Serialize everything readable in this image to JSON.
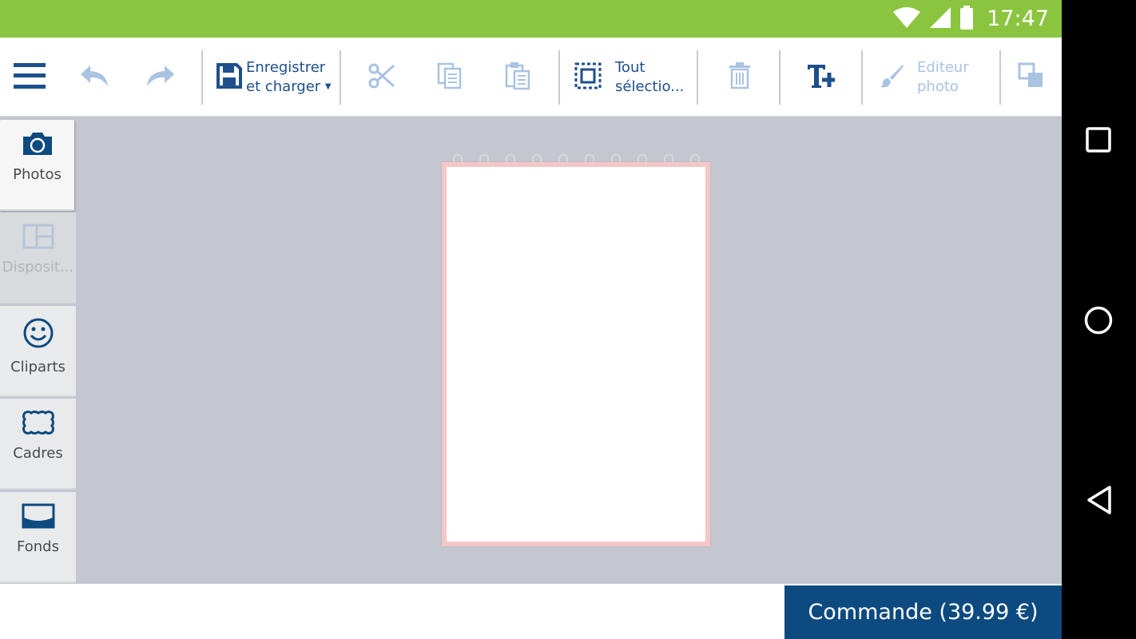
{
  "status_bar": {
    "time": "17:47",
    "background": "#8bc53f",
    "icons": [
      "wifi-icon",
      "signal-icon",
      "battery-icon"
    ]
  },
  "toolbar": {
    "save_load_label_line1": "Enregistrer",
    "save_load_label_line2": "et charger",
    "select_all_label_line1": "Tout",
    "select_all_label_line2": "sélectio...",
    "photo_editor_label_line1": "Editeur",
    "photo_editor_label_line2": "photo",
    "icons": [
      "menu-icon",
      "undo-icon",
      "redo-icon",
      "save-icon",
      "cut-icon",
      "copy-icon",
      "paste-icon",
      "select-all-icon",
      "delete-icon",
      "add-text-icon",
      "brush-icon",
      "arrange-icon"
    ]
  },
  "sidebar": {
    "items": [
      {
        "label": "Photos",
        "icon": "camera-icon",
        "state": "active"
      },
      {
        "label": "Disposit...",
        "icon": "layout-icon",
        "state": "disabled"
      },
      {
        "label": "Cliparts",
        "icon": "smiley-icon",
        "state": "normal"
      },
      {
        "label": "Cadres",
        "icon": "frame-icon",
        "state": "normal"
      },
      {
        "label": "Fonds",
        "icon": "background-icon",
        "state": "normal"
      }
    ]
  },
  "order": {
    "label": "Commande (39.99 €)",
    "background": "#0d4a80"
  },
  "colors": {
    "accent": "#1d4f8c",
    "workspace": "#c4c7d0"
  }
}
